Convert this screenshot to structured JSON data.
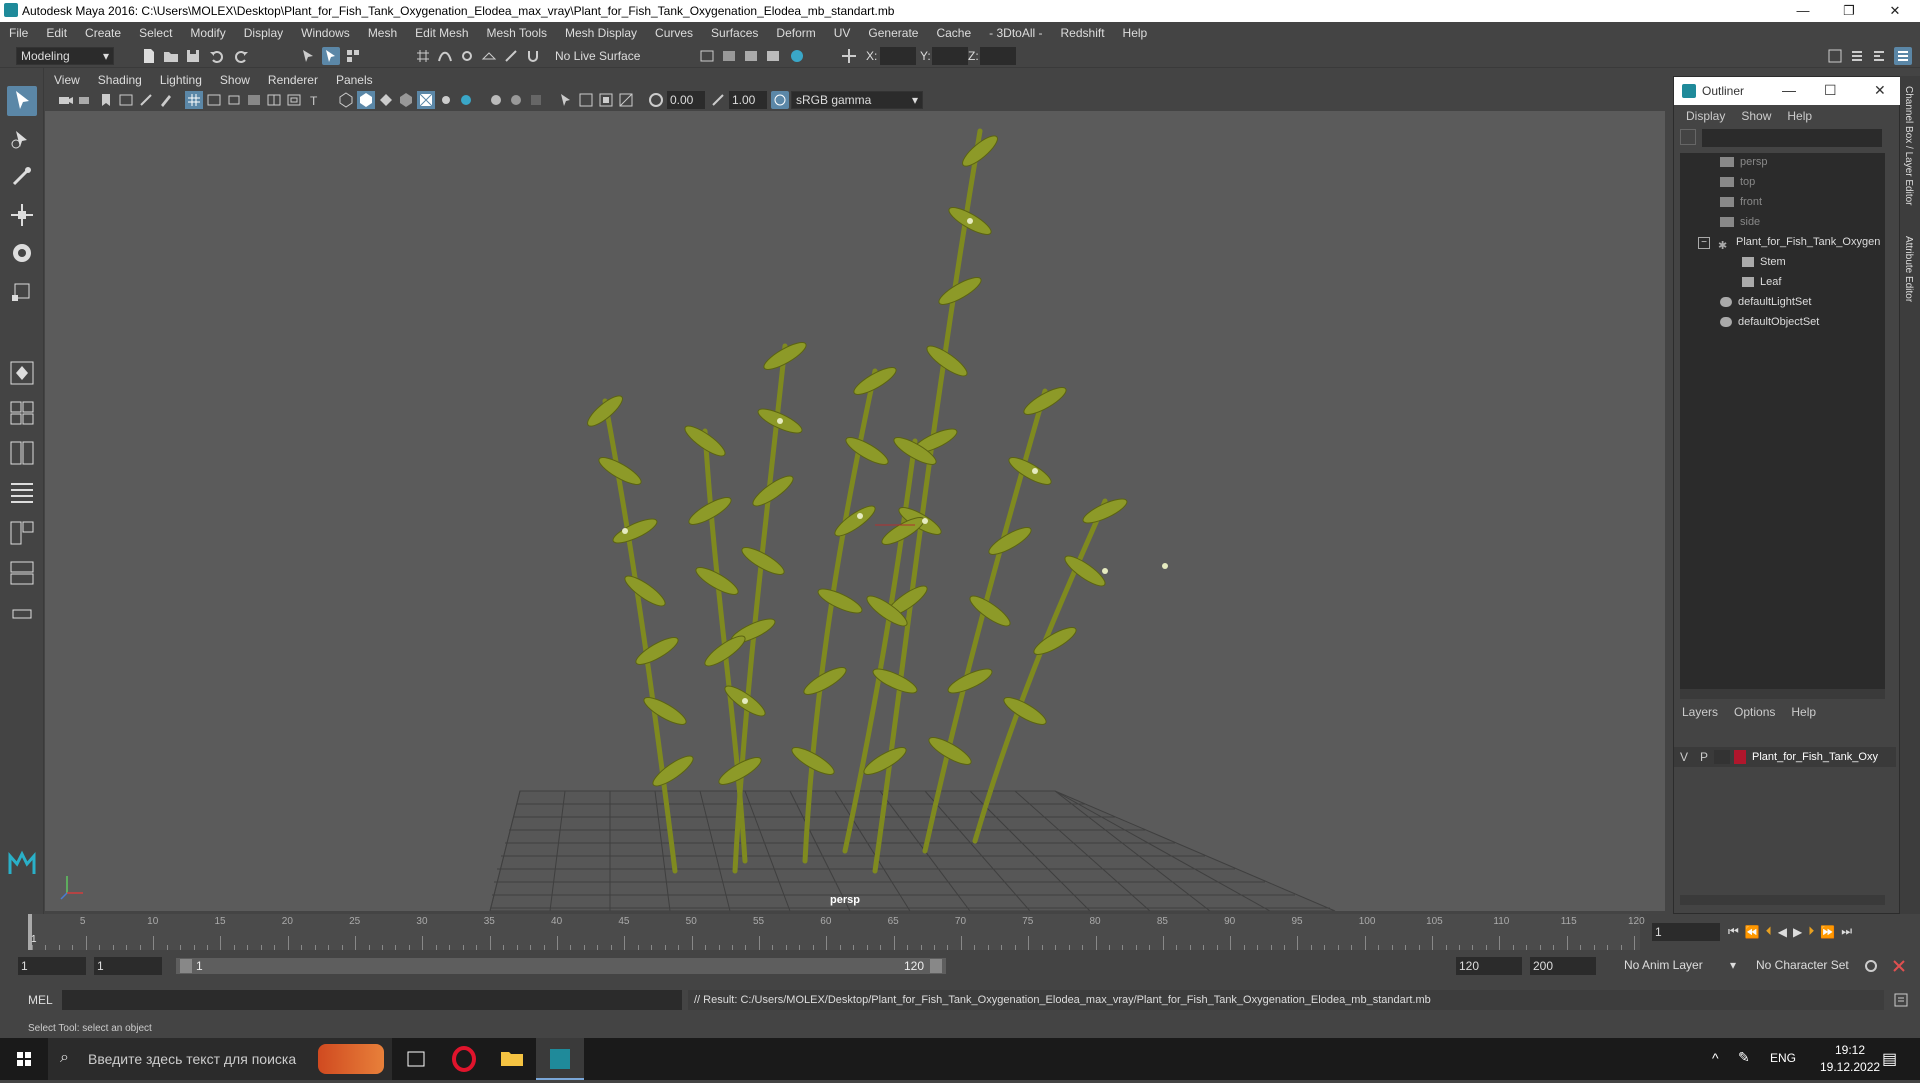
{
  "window": {
    "title": "Autodesk Maya 2016: C:\\Users\\MOLEX\\Desktop\\Plant_for_Fish_Tank_Oxygenation_Elodea_max_vray\\Plant_for_Fish_Tank_Oxygenation_Elodea_mb_standart.mb",
    "minimize": "—",
    "restore": "❐",
    "close": "✕"
  },
  "menubar": [
    "File",
    "Edit",
    "Create",
    "Select",
    "Modify",
    "Display",
    "Windows",
    "Mesh",
    "Edit Mesh",
    "Mesh Tools",
    "Mesh Display",
    "Curves",
    "Surfaces",
    "Deform",
    "UV",
    "Generate",
    "Cache",
    "- 3DtoAll -",
    "Redshift",
    "Help"
  ],
  "statusline": {
    "mode": "Modeling",
    "live_surface": "No Live Surface",
    "x_label": "X:",
    "y_label": "Y:",
    "z_label": "Z:"
  },
  "viewport": {
    "menu": [
      "View",
      "Shading",
      "Lighting",
      "Show",
      "Renderer",
      "Panels"
    ],
    "field_a": "0.00",
    "field_b": "1.00",
    "color_space": "sRGB gamma",
    "camera_label": "persp"
  },
  "outliner": {
    "title": "Outliner",
    "menu": [
      "Display",
      "Show",
      "Help"
    ],
    "items": [
      {
        "label": "persp",
        "dim": true
      },
      {
        "label": "top",
        "dim": true
      },
      {
        "label": "front",
        "dim": true
      },
      {
        "label": "side",
        "dim": true
      },
      {
        "label": "Plant_for_Fish_Tank_Oxygen",
        "dim": false
      },
      {
        "label": "Stem",
        "dim": false
      },
      {
        "label": "Leaf",
        "dim": false
      },
      {
        "label": "defaultLightSet",
        "dim": false
      },
      {
        "label": "defaultObjectSet",
        "dim": false
      }
    ],
    "layers_menu": [
      "Layers",
      "Options",
      "Help"
    ],
    "layer": {
      "v": "V",
      "p": "P",
      "name": "Plant_for_Fish_Tank_Oxy",
      "color": "#b0162c"
    }
  },
  "sidetabs": [
    "Channel Box / Layer Editor",
    "Attribute Editor"
  ],
  "timeline": {
    "ticks": [
      "5",
      "10",
      "15",
      "20",
      "25",
      "30",
      "35",
      "40",
      "45",
      "50",
      "55",
      "60",
      "65",
      "70",
      "75",
      "80",
      "85",
      "90",
      "95",
      "100",
      "105",
      "110",
      "115",
      "120"
    ],
    "start_marker": "1",
    "current_frame": "1"
  },
  "range": {
    "start": "1",
    "start2": "1",
    "slider_start": "1",
    "slider_end": "120",
    "end": "120",
    "end2": "200",
    "anim_layer": "No Anim Layer",
    "char_set": "No Character Set"
  },
  "cmdline": {
    "lang": "MEL",
    "result": "// Result: C:/Users/MOLEX/Desktop/Plant_for_Fish_Tank_Oxygenation_Elodea_max_vray/Plant_for_Fish_Tank_Oxygenation_Elodea_mb_standart.mb"
  },
  "helpline": "Select Tool: select an object",
  "taskbar": {
    "search_placeholder": "Введите здесь текст для поиска",
    "lang": "ENG",
    "time": "19:12",
    "date": "19.12.2022"
  }
}
